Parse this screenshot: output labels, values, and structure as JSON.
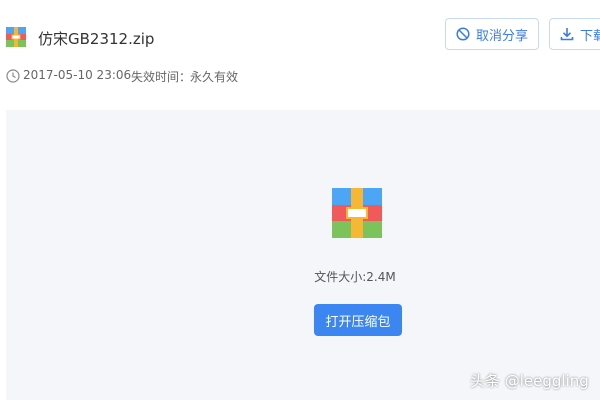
{
  "file": {
    "name": "仿宋GB2312.zip",
    "date": "2017-05-10 23:06",
    "expiry_label": "失效时间：",
    "expiry_value": "永久有效",
    "size_text": "文件大小:2.4M",
    "icon": "archive-icon"
  },
  "toolbar": {
    "cancel_share_label": "取消分享",
    "cancel_share_icon": "prohibit-icon",
    "download_label": "下载",
    "download_icon": "download-icon"
  },
  "actions": {
    "open_archive_label": "打开压缩包"
  },
  "watermark": "头条 @leeggling",
  "colors": {
    "accent": "#3b86f0",
    "button_border": "#c9d9f2",
    "content_bg": "#f5f6fa"
  }
}
